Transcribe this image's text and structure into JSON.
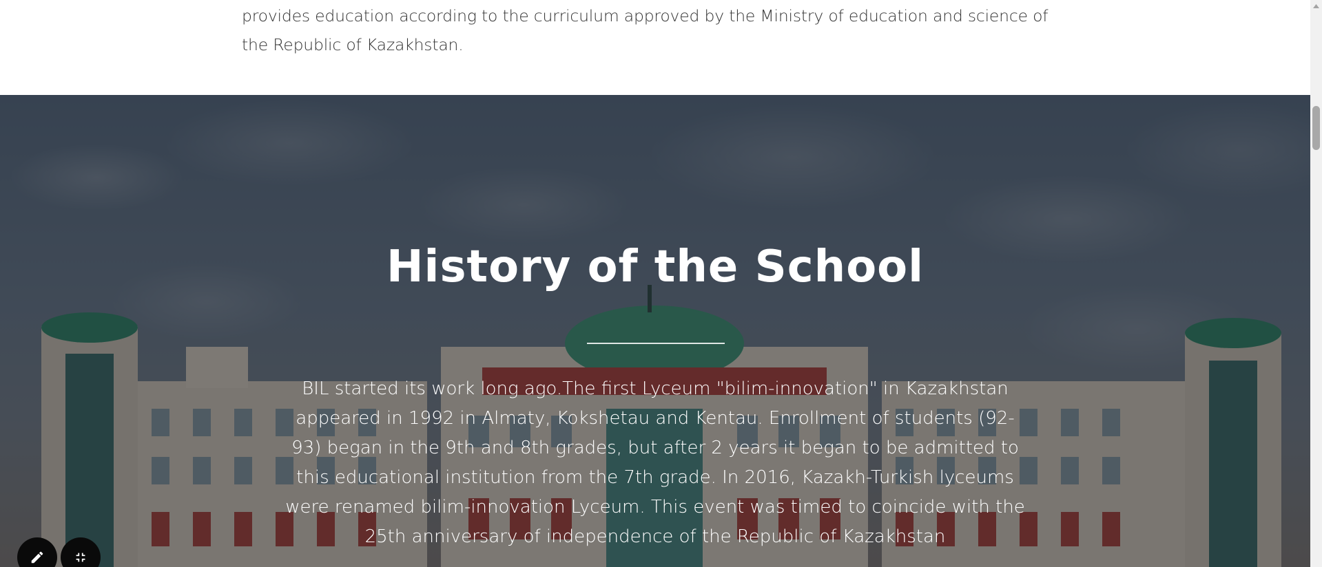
{
  "intro": {
    "text": "provides education according to the curriculum approved by the Ministry of education and science of the Republic of Kazakhstan."
  },
  "history": {
    "title": "History of the School",
    "body": "BIL started its work long ago.The first Lyceum \"bilim-innovation\" in Kazakhstan appeared in 1992 in Almaty, Kokshetau and Kentau. Enrollment of students (92-93) began in the 9th and 8th grades, but after 2 years it began to be admitted to this educational institution from the 7th grade. In 2016, Kazakh-Turkish lyceums were renamed bilim-innovation Lyceum. This event was timed to coincide with the 25th anniversary of independence of the Republic of Kazakhstan"
  },
  "tools": {
    "edit_icon": "pencil-icon",
    "collapse_icon": "collapse-icon"
  },
  "colors": {
    "overlay": "#14161c",
    "fab": "#0a0a0a",
    "text_light": "#ffffff",
    "text_dark": "#333333"
  }
}
